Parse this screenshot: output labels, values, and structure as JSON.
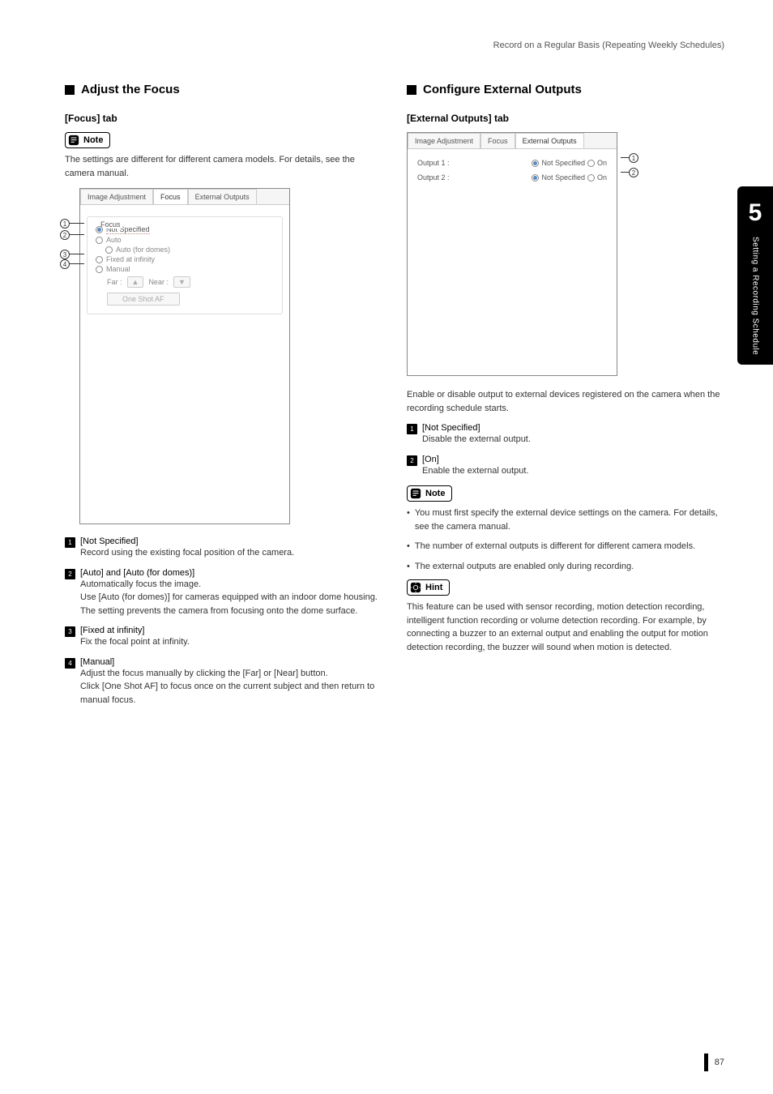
{
  "header": "Record on a Regular Basis (Repeating Weekly Schedules)",
  "left": {
    "section_title": "Adjust the Focus",
    "tab_heading": "[Focus] tab",
    "note_label": "Note",
    "note_text": "The settings are different for different camera models. For details, see the camera manual.",
    "tabs": {
      "t1": "Image Adjustment",
      "t2": "Focus",
      "t3": "External Outputs"
    },
    "fieldset": "Focus",
    "radios": {
      "not_specified": "Not Specified",
      "auto": "Auto",
      "auto_domes": "Auto (for domes)",
      "fixed": "Fixed at infinity",
      "manual": "Manual"
    },
    "btns": {
      "far": "Far :",
      "near": "Near :",
      "oneshot": "One Shot AF"
    },
    "defs": [
      {
        "n": "1",
        "label": "[Not Specified]",
        "desc": "Record using the existing focal position of the camera."
      },
      {
        "n": "2",
        "label": "[Auto] and [Auto (for domes)]",
        "desc": "Automatically focus the image.\nUse [Auto (for domes)] for cameras equipped with an indoor dome housing. The setting prevents the camera from focusing onto the dome surface."
      },
      {
        "n": "3",
        "label": "[Fixed at infinity]",
        "desc": "Fix the focal point at infinity."
      },
      {
        "n": "4",
        "label": "[Manual]",
        "desc": "Adjust the focus manually by clicking the [Far] or [Near] button.\nClick [One Shot AF] to focus once on the current subject and then return to manual focus."
      }
    ]
  },
  "right": {
    "section_title": "Configure External Outputs",
    "tab_heading": "[External Outputs] tab",
    "tabs": {
      "t1": "Image Adjustment",
      "t2": "Focus",
      "t3": "External Outputs"
    },
    "rows": {
      "out1": "Output 1 :",
      "out2": "Output 2 :",
      "ns": "Not Specified",
      "on": "On"
    },
    "intro": "Enable or disable output to external devices registered on the camera when the recording schedule starts.",
    "defs": [
      {
        "n": "1",
        "label": "[Not Specified]",
        "desc": "Disable the external output."
      },
      {
        "n": "2",
        "label": "[On]",
        "desc": "Enable the external output."
      }
    ],
    "note_label": "Note",
    "notes": [
      "You must first specify the external device settings on the camera. For details, see the camera manual.",
      "The number of external outputs is different for different camera models.",
      "The external outputs are enabled only during recording."
    ],
    "hint_label": "Hint",
    "hint_text": "This feature can be used with sensor recording, motion detection recording, intelligent function recording or volume detection recording. For example, by connecting a buzzer to an external output and enabling the output for motion detection recording, the buzzer will sound when motion is detected."
  },
  "side": {
    "num": "5",
    "text": "Setting a Recording Schedule"
  },
  "page_num": "87"
}
